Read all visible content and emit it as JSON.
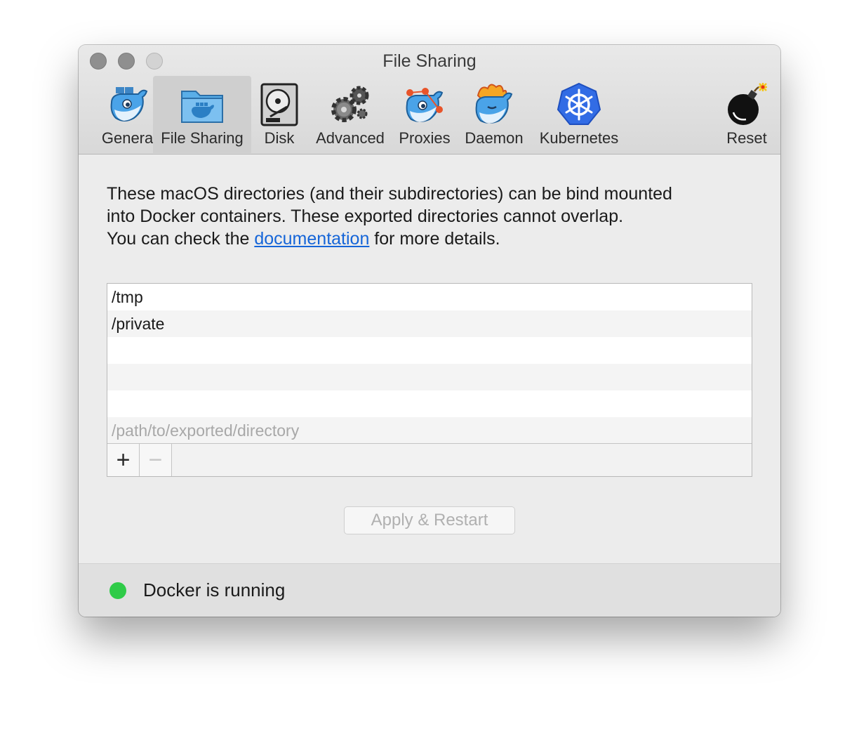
{
  "window": {
    "title": "File Sharing"
  },
  "tabs": [
    {
      "label": "General",
      "icon": "whale-icon"
    },
    {
      "label": "File Sharing",
      "icon": "folder-whale-icon",
      "active": true
    },
    {
      "label": "Disk",
      "icon": "hard-disk-icon"
    },
    {
      "label": "Advanced",
      "icon": "gears-icon"
    },
    {
      "label": "Proxies",
      "icon": "whale-proxies-icon"
    },
    {
      "label": "Daemon",
      "icon": "whale-daemon-icon"
    },
    {
      "label": "Kubernetes",
      "icon": "kubernetes-helm-icon"
    },
    {
      "label": "Reset",
      "icon": "bomb-icon"
    }
  ],
  "description": {
    "line1": "These macOS directories (and their subdirectories) can be bind mounted",
    "line2": "into Docker containers. These exported directories cannot overlap.",
    "line3_prefix": "You can check the ",
    "link": "documentation",
    "line3_suffix": " for more details."
  },
  "shared_dirs": [
    "/tmp",
    "/private",
    "",
    "",
    ""
  ],
  "path_placeholder": "/path/to/exported/directory",
  "list_tools": {
    "add": "+",
    "remove": "−"
  },
  "apply_button": "Apply & Restart",
  "status": {
    "text": "Docker is running",
    "color": "#2fcb48"
  },
  "colors": {
    "link": "#1565d8",
    "docker_blue": "#4aa3e8"
  }
}
